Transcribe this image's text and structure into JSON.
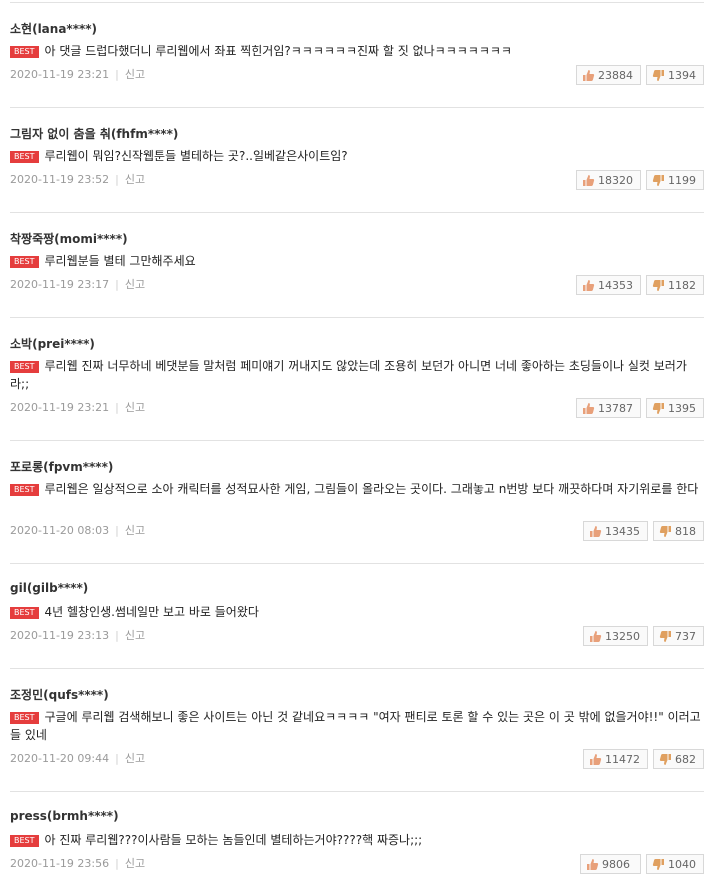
{
  "comments": [
    {
      "author": "소현(lana****)",
      "text": "아 댓글 드럽다했더니 루리웹에서 좌표 찍힌거임?ㅋㅋㅋㅋㅋㅋ진짜 할 짓 없나ㅋㅋㅋㅋㅋㅋㅋ",
      "date": "2020-11-19 23:21",
      "likes": "23884",
      "dislikes": "1394"
    },
    {
      "author": "그림자 없이 춤을 춰(fhfm****)",
      "text": "루리웹이 뭐임?신작웹툰들 별테하는 곳?..일베같은사이트임?",
      "date": "2020-11-19 23:52",
      "likes": "18320",
      "dislikes": "1199"
    },
    {
      "author": "착짱죽짱(momi****)",
      "text": "루리웹분들 별테 그만해주세요",
      "date": "2020-11-19 23:17",
      "likes": "14353",
      "dislikes": "1182"
    },
    {
      "author": "소박(prei****)",
      "text": "루리웹 진짜 너무하네 베댓분들 말처럼 페미얘기 꺼내지도 않았는데 조용히 보던가 아니면 너네 좋아하는 초딩들이나 실컷 보러가라;;",
      "date": "2020-11-19 23:21",
      "likes": "13787",
      "dislikes": "1395"
    },
    {
      "author": "포로롱(fpvm****)",
      "text": "루리웹은 일상적으로 소아 캐릭터를 성적묘사한 게임, 그림들이 올라오는 곳이다. 그래놓고 n번방 보다 깨끗하다며 자기위로를 한다",
      "date": "2020-11-20 08:03",
      "likes": "13435",
      "dislikes": "818"
    },
    {
      "author": "gil(gilb****)",
      "text": "4년 헬창인생.썸네일만 보고 바로 들어왔다",
      "date": "2020-11-19 23:13",
      "likes": "13250",
      "dislikes": "737"
    },
    {
      "author": "조정민(qufs****)",
      "text": "구글에 루리웹 검색해보니 좋은 사이트는 아닌 것 같네요ㅋㅋㅋㅋ \"여자 팬티로 토론 할 수 있는 곳은 이 곳 밖에 없을거야!!\" 이러고들 있네",
      "date": "2020-11-20 09:44",
      "likes": "11472",
      "dislikes": "682"
    },
    {
      "author": "press(brmh****)",
      "text": "아 진짜 루리웹???이사람들 모하는 놈들인데 별테하는거야????핵 짜증나;;;",
      "date": "2020-11-19 23:56",
      "likes": "9806",
      "dislikes": "1040"
    }
  ],
  "labels": {
    "best": "BEST",
    "report": "신고"
  },
  "icons": {
    "like": "thumbs-up-icon",
    "dislike": "thumbs-down-icon"
  },
  "colors": {
    "best_badge": "#e53d3d",
    "like_icon": "#e8a07a",
    "dislike_icon": "#e0a060"
  }
}
